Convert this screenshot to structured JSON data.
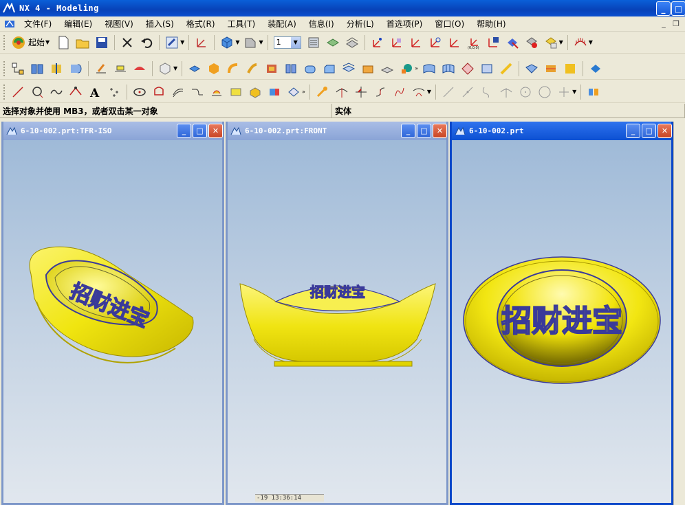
{
  "window": {
    "title": "NX 4 - Modeling"
  },
  "menu": {
    "items": [
      {
        "label": "文件(F)"
      },
      {
        "label": "编辑(E)"
      },
      {
        "label": "视图(V)"
      },
      {
        "label": "插入(S)"
      },
      {
        "label": "格式(R)"
      },
      {
        "label": "工具(T)"
      },
      {
        "label": "装配(A)"
      },
      {
        "label": "信息(I)"
      },
      {
        "label": "分析(L)"
      },
      {
        "label": "首选项(P)"
      },
      {
        "label": "窗口(O)"
      },
      {
        "label": "帮助(H)"
      }
    ]
  },
  "toolbar": {
    "start_label": "起始",
    "layer_value": "1"
  },
  "status": {
    "prompt": "选择对象并使用 MB3，或者双击某一对象",
    "type": "实体"
  },
  "viewports": [
    {
      "title": "6-10-002.prt:TFR-ISO",
      "engraving": "招财进宝"
    },
    {
      "title": "6-10-002.prt:FRONT",
      "engraving": "招财进宝"
    },
    {
      "title": "6-10-002.prt",
      "engraving": "招财进宝"
    }
  ],
  "timestamp": "-19 13:36:14",
  "colors": {
    "model": "#f2e80f",
    "text": "#3a3a9a",
    "accent": "#0b48c9"
  }
}
